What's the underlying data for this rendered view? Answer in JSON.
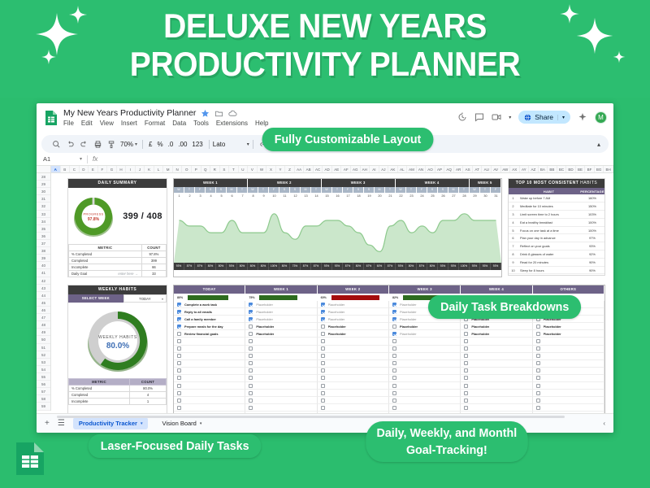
{
  "hero": {
    "line1": "DELUXE NEW YEARS",
    "line2": "PRODUCTIVITY PLANNER",
    "bg_color": "#2cbe70"
  },
  "callouts": {
    "layout": "Fully Customizable Layout",
    "tasks": "Daily Task Breakdowns",
    "laser": "Laser-Focused Daily Tasks",
    "tracking_line1": "Daily, Weekly, and Monthl",
    "tracking_line2": "Goal-Tracking!"
  },
  "app": {
    "doc_name": "My New Years Productivity Planner",
    "menu": [
      "File",
      "Edit",
      "View",
      "Insert",
      "Format",
      "Data",
      "Tools",
      "Extensions",
      "Help"
    ],
    "share_label": "Share",
    "avatar_initial": "M",
    "toolbar": {
      "zoom": "70%",
      "currency": "£",
      "percent": "%",
      "decimal_dec": ".0",
      "decimal_inc": ".00",
      "format_123": "123",
      "font": "Lato"
    },
    "formula_bar": {
      "cell_ref": "A1",
      "formula": ""
    },
    "columns": [
      "A",
      "B",
      "C",
      "D",
      "E",
      "F",
      "G",
      "H",
      "I",
      "J",
      "K",
      "L",
      "M",
      "N",
      "O",
      "P",
      "Q",
      "R",
      "S",
      "T",
      "U",
      "V",
      "W",
      "X",
      "Y",
      "Z",
      "AA",
      "AB",
      "AC",
      "AD",
      "AE",
      "AF",
      "AG",
      "AH",
      "AI",
      "AJ",
      "AK",
      "AL",
      "AM",
      "AN",
      "AO",
      "AP",
      "AQ",
      "AR",
      "AS",
      "AT",
      "AU",
      "AV",
      "AW",
      "AX",
      "AY",
      "AZ",
      "BA",
      "BB",
      "BC",
      "BD",
      "BE",
      "BF",
      "BG",
      "BH"
    ],
    "selected_column": "A",
    "row_start": 28,
    "row_count": 32,
    "tabs": [
      {
        "label": "Productivity Tracker",
        "active": true
      },
      {
        "label": "Vision Board",
        "active": false
      }
    ]
  },
  "daily_summary": {
    "title": "DAILY SUMMARY",
    "donut_label": "PROGRESS",
    "donut_value": "97.8%",
    "fraction": "399 / 408",
    "columns": [
      "METRIC",
      "COUNT"
    ],
    "rows": [
      {
        "metric": "% Completed",
        "count": "97.8%"
      },
      {
        "metric": "Completed",
        "count": "399"
      },
      {
        "metric": "Incomplete",
        "count": "66"
      },
      {
        "metric": "Daily Goal",
        "hint": "enter here →",
        "count": "33"
      }
    ]
  },
  "weekly_habits": {
    "title": "WEEKLY HABITS",
    "select_label": "SELECT WEEK",
    "select_value": "TODAY",
    "donut_label": "WEEKLY HABITS",
    "donut_value": "80.0%",
    "columns": [
      "METRIC",
      "COUNT"
    ],
    "rows": [
      {
        "metric": "% Completed",
        "count": "80.0%"
      },
      {
        "metric": "Completed",
        "count": "4"
      },
      {
        "metric": "Incomplete",
        "count": "1"
      }
    ]
  },
  "top_habits": {
    "title_bold": "TOP 10 MOST CONSISTENT",
    "title_light": "HABITS",
    "columns": [
      "HABIT",
      "PERCENTAGE"
    ],
    "rows": [
      {
        "rank": "1",
        "habit": "Wake up before 7 AM",
        "pct": "160%"
      },
      {
        "rank": "2",
        "habit": "Meditate for 10 minutes",
        "pct": "150%"
      },
      {
        "rank": "3",
        "habit": "Limit screen time to 2 hours",
        "pct": "103%"
      },
      {
        "rank": "4",
        "habit": "Eat a healthy breakfast",
        "pct": "100%"
      },
      {
        "rank": "5",
        "habit": "Focus on one task at a time",
        "pct": "100%"
      },
      {
        "rank": "6",
        "habit": "Plan your day in advance",
        "pct": "97%"
      },
      {
        "rank": "7",
        "habit": "Reflect on your goals",
        "pct": "93%"
      },
      {
        "rank": "8",
        "habit": "Drink 8 glasses of water",
        "pct": "92%"
      },
      {
        "rank": "9",
        "habit": "Read for 20 minutes",
        "pct": "90%"
      },
      {
        "rank": "10",
        "habit": "Sleep for 8 hours",
        "pct": "90%"
      }
    ]
  },
  "chart_data": {
    "type": "area",
    "title": "",
    "xlabel": "",
    "ylabel": "",
    "ylim": [
      0,
      100
    ],
    "grid": false,
    "legend": "none",
    "weeks": [
      {
        "label": "WEEK 1",
        "days": 7
      },
      {
        "label": "WEEK 2",
        "days": 7
      },
      {
        "label": "WEEK 3",
        "days": 7
      },
      {
        "label": "WEEK 4",
        "days": 7
      },
      {
        "label": "WEEK 5",
        "days": 3
      }
    ],
    "day_letters": [
      "W",
      "T",
      "F",
      "S",
      "S",
      "M",
      "T",
      "W",
      "T",
      "F",
      "S",
      "S",
      "M",
      "T",
      "W",
      "T",
      "F",
      "S",
      "S",
      "M",
      "T",
      "W",
      "T",
      "F",
      "S",
      "S",
      "M",
      "T",
      "W",
      "T",
      "F"
    ],
    "categories": [
      "1",
      "2",
      "3",
      "4",
      "5",
      "6",
      "7",
      "8",
      "9",
      "10",
      "11",
      "12",
      "13",
      "14",
      "15",
      "16",
      "17",
      "18",
      "19",
      "20",
      "21",
      "22",
      "23",
      "24",
      "25",
      "26",
      "27",
      "28",
      "29",
      "30",
      "31"
    ],
    "values": [
      93,
      87,
      87,
      80,
      80,
      93,
      80,
      80,
      80,
      100,
      80,
      73,
      87,
      87,
      93,
      93,
      87,
      80,
      67,
      60,
      87,
      93,
      80,
      87,
      80,
      93,
      93,
      100,
      93,
      93,
      93
    ],
    "tick_labels": [
      "93%",
      "87%",
      "87%",
      "80%",
      "80%",
      "93%",
      "80%",
      "80%",
      "80%",
      "100%",
      "80%",
      "73%",
      "87%",
      "87%",
      "93%",
      "93%",
      "87%",
      "80%",
      "67%",
      "60%",
      "87%",
      "93%",
      "80%",
      "87%",
      "80%",
      "93%",
      "93%",
      "100%",
      "93%",
      "93%",
      "93%"
    ],
    "series": [
      {
        "name": "Daily Completion",
        "color": "#8cc98c",
        "values": [
          93,
          87,
          87,
          80,
          80,
          93,
          80,
          80,
          80,
          100,
          80,
          73,
          87,
          87,
          93,
          93,
          87,
          80,
          67,
          60,
          87,
          93,
          80,
          87,
          80,
          93,
          93,
          100,
          93,
          93,
          93
        ]
      }
    ]
  },
  "task_board": {
    "columns": [
      {
        "label": "TODAY",
        "pct": "80%",
        "bar_pct": 80,
        "bar_color": "#2d6b1f"
      },
      {
        "label": "WEEK 1",
        "pct": "75%",
        "bar_pct": 75,
        "bar_color": "#2d6b1f"
      },
      {
        "label": "WEEK 2",
        "pct": "60%",
        "bar_pct": 95,
        "bar_color": "#a40c0c"
      },
      {
        "label": "WEEK 3",
        "pct": "82%",
        "bar_pct": 82,
        "bar_color": "#2d6b1f"
      },
      {
        "label": "WEEK 4",
        "pct": "",
        "bar_pct": 0,
        "bar_color": "#2d6b1f"
      },
      {
        "label": "OTHERS",
        "pct": "",
        "bar_pct": 0,
        "bar_color": "#2d6b1f"
      }
    ],
    "placeholder_label": "Placeholder",
    "today_tasks": [
      {
        "text": "Complete a work task",
        "checked": true
      },
      {
        "text": "Reply to all emails",
        "checked": true
      },
      {
        "text": "Call a family member",
        "checked": true
      },
      {
        "text": "Prepare meals for the day",
        "checked": true
      },
      {
        "text": "Review financial goals",
        "checked": false
      }
    ],
    "week1_checks": [
      true,
      true,
      true,
      false,
      false
    ],
    "week2_checks": [
      true,
      true,
      true,
      false,
      false
    ],
    "week3_checks": [
      true,
      true,
      true,
      false,
      true
    ],
    "week4_checks": [
      false,
      false,
      false,
      false,
      false
    ],
    "others_checks": [
      false,
      false,
      false,
      false,
      false
    ],
    "empty_rows": 11
  }
}
